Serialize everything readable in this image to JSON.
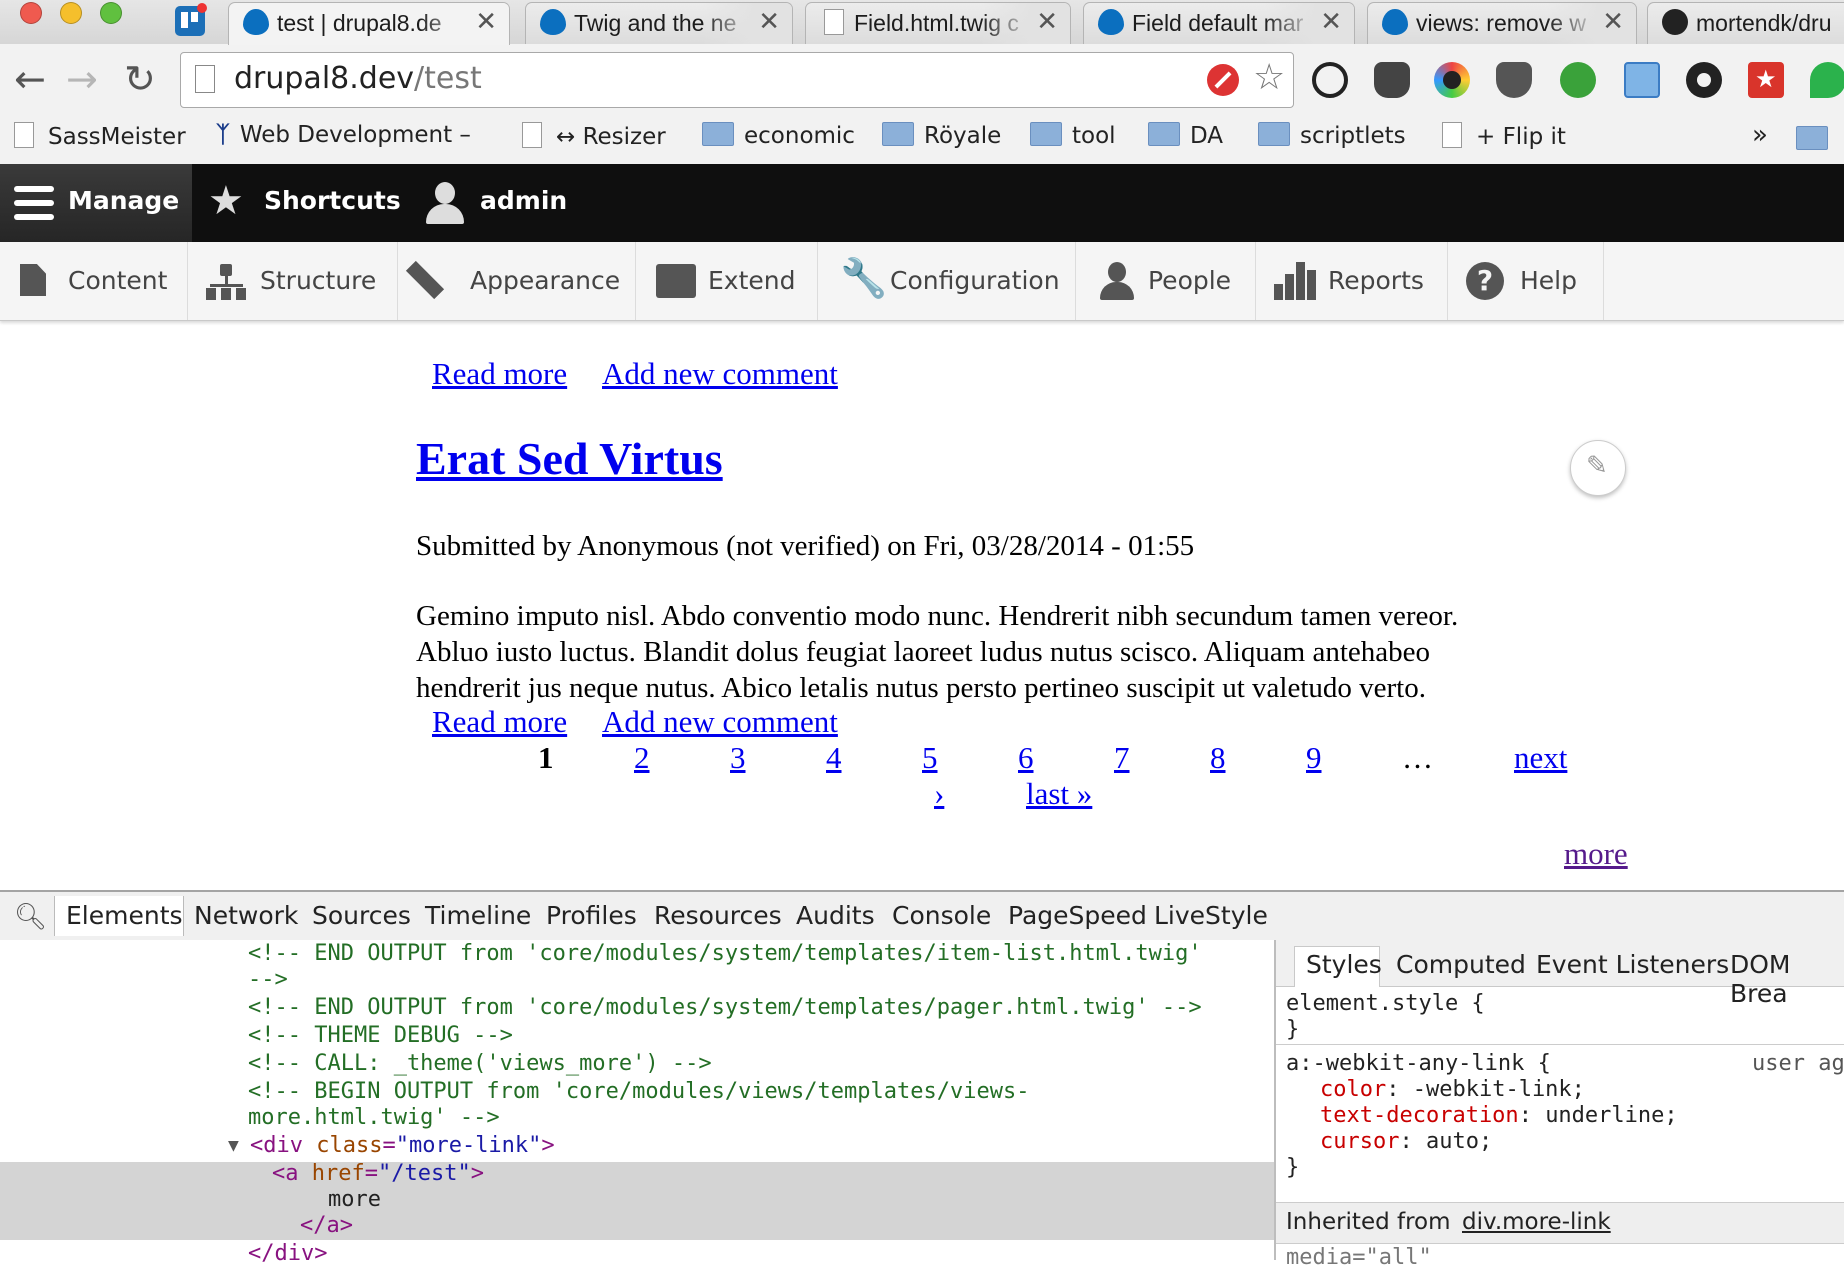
{
  "browser": {
    "tabs": [
      {
        "title": "test | drupal8.de",
        "icon": "drupal-icon",
        "active": true
      },
      {
        "title": "Twig and the ne",
        "icon": "drupal-icon",
        "active": false
      },
      {
        "title": "Field.html.twig c",
        "icon": "page-icon",
        "active": false
      },
      {
        "title": "Field default mar",
        "icon": "drupal-icon",
        "active": false
      },
      {
        "title": "views: remove w",
        "icon": "drupal-icon",
        "active": false
      },
      {
        "title": "mortendk/dru",
        "icon": "github-icon",
        "active": false
      }
    ],
    "tab_close_glyph": "✕",
    "url_host": "drupal8.dev",
    "url_path": "/test",
    "bookmarks": [
      {
        "label": "SassMeister",
        "icon": "page-icon"
      },
      {
        "label": "Web Development –",
        "icon": "web-dev-icon"
      },
      {
        "label": "↔ Resizer",
        "icon": "page-icon"
      },
      {
        "label": "economic",
        "icon": "folder-icon"
      },
      {
        "label": "Röyale",
        "icon": "folder-icon"
      },
      {
        "label": "tool",
        "icon": "folder-icon"
      },
      {
        "label": "DA",
        "icon": "folder-icon"
      },
      {
        "label": "scriptlets",
        "icon": "folder-icon"
      },
      {
        "label": "+ Flip it",
        "icon": "page-icon"
      }
    ],
    "bookmarks_overflow": "»"
  },
  "drupal_toolbar": {
    "manage": "Manage",
    "shortcuts": "Shortcuts",
    "user": "admin",
    "tray": [
      {
        "label": "Content",
        "icon": "content-icon"
      },
      {
        "label": "Structure",
        "icon": "structure-icon"
      },
      {
        "label": "Appearance",
        "icon": "appearance-icon"
      },
      {
        "label": "Extend",
        "icon": "extend-icon"
      },
      {
        "label": "Configuration",
        "icon": "configuration-icon"
      },
      {
        "label": "People",
        "icon": "people-icon"
      },
      {
        "label": "Reports",
        "icon": "reports-icon"
      },
      {
        "label": "Help",
        "icon": "help-icon"
      }
    ]
  },
  "content": {
    "links_top": {
      "read_more": "Read more",
      "add_comment": "Add new comment"
    },
    "article": {
      "title": "Erat Sed Virtus",
      "submitted": "Submitted by Anonymous (not verified) on Fri, 03/28/2014 - 01:55",
      "body_lines": [
        "Gemino imputo nisl. Abdo conventio modo nunc. Hendrerit nibh secundum tamen vereor.",
        "Abluo iusto luctus. Blandit dolus feugiat laoreet ludus nutus scisco. Aliquam antehabeo",
        "hendrerit jus neque nutus. Abico letalis nutus persto pertineo suscipit ut valetudo verto."
      ],
      "read_more": "Read more",
      "add_comment": "Add new comment"
    },
    "pager": {
      "current": "1",
      "pages": [
        "2",
        "3",
        "4",
        "5",
        "6",
        "7",
        "8",
        "9"
      ],
      "ellipsis": "…",
      "next_word": "next",
      "next_arrow": "›",
      "last": "last »"
    },
    "more": "more"
  },
  "devtools": {
    "tabs": [
      "Elements",
      "Network",
      "Sources",
      "Timeline",
      "Profiles",
      "Resources",
      "Audits",
      "Console",
      "PageSpeed",
      "LiveStyle"
    ],
    "active_tab": "Elements",
    "dom_lines": {
      "l1": "<!-- END OUTPUT from 'core/modules/system/templates/item-list.html.twig'",
      "l2": "-->",
      "l3": "<!-- END OUTPUT from 'core/modules/system/templates/pager.html.twig' -->",
      "l4": "<!-- THEME DEBUG -->",
      "l5": "<!-- CALL: _theme('views_more') -->",
      "l6": "<!-- BEGIN OUTPUT from 'core/modules/views/templates/views-",
      "l7": "more.html.twig' -->",
      "div_open_tag": "<div",
      "div_attr_name": "class",
      "div_attr_value": "\"more-link\"",
      "a_open_tag": "<a",
      "a_attr_name": "href",
      "a_attr_value": "\"/test\"",
      "a_text": "more",
      "a_close": "</a>",
      "div_close": "</div>"
    },
    "side_tabs": [
      "Styles",
      "Computed",
      "Event Listeners",
      "DOM Brea"
    ],
    "styles": {
      "element_style": "element.style {",
      "close_brace": "}",
      "selector": "a:-webkit-any-link {",
      "origin": "user ag",
      "props": [
        {
          "name": "color",
          "value": "-webkit-link;"
        },
        {
          "name": "text-decoration",
          "value": "underline;"
        },
        {
          "name": "cursor",
          "value": "auto;"
        }
      ],
      "inherited_label": "Inherited from",
      "inherited_link": "div.more-link",
      "media": "media=\"all\""
    }
  }
}
